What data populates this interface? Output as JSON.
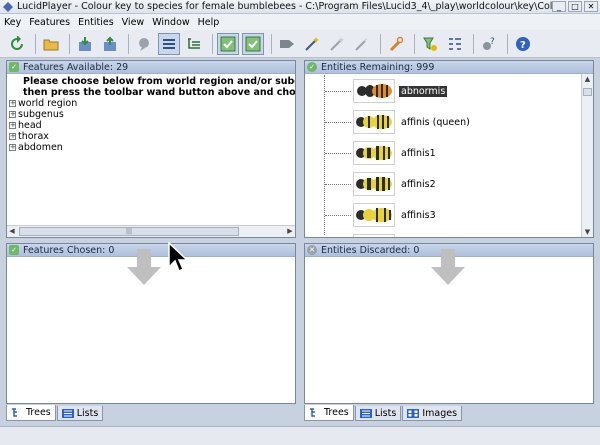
{
  "window": {
    "title": "LucidPlayer - Colour key to species for female bumblebees - C:\\Program Files\\Lucid3_4\\_play\\worldcolour\\key\\Colour key t...",
    "buttons": [
      "_",
      "□",
      "✕"
    ]
  },
  "menu": [
    "Key",
    "Features",
    "Entities",
    "View",
    "Window",
    "Help"
  ],
  "toolbar": {
    "icons": [
      "restart-icon",
      "open-folder-icon",
      "import-icon",
      "export-icon",
      "chat-icon",
      "list-view-icon",
      "tree-view-icon",
      "check-features-icon",
      "check-entities-icon",
      "tag-icon",
      "magic-wand-icon",
      "wand-disabled-icon",
      "wand-gray-icon",
      "tool-icon",
      "filter-icon",
      "sort-icon",
      "settings-help-icon",
      "help-icon"
    ]
  },
  "features_available": {
    "header": "Features Available: 29",
    "instructions": [
      "Please choose below from world region and/or subgenus (optio",
      "then press the toolbar wand button above and choose a feature"
    ],
    "items": [
      "world region",
      "subgenus",
      "head",
      "thorax",
      "abdomen"
    ]
  },
  "entities_remaining": {
    "header": "Entities Remaining: 999",
    "items": [
      {
        "name": "abnormis",
        "selected": true
      },
      {
        "name": "affinis (queen)",
        "selected": false
      },
      {
        "name": "affinis1",
        "selected": false
      },
      {
        "name": "affinis2",
        "selected": false
      },
      {
        "name": "affinis3",
        "selected": false
      }
    ]
  },
  "features_chosen": {
    "header": "Features Chosen: 0"
  },
  "entities_discarded": {
    "header": "Entities Discarded: 0"
  },
  "left_tabs": [
    "Trees",
    "Lists"
  ],
  "right_tabs": [
    "Trees",
    "Lists",
    "Images"
  ],
  "colors": {
    "header_bg": "#b6c6df",
    "selected_bg": "#333333",
    "bee_yellow": "#e8d23a",
    "bee_black": "#2b2b2b",
    "bee_orange": "#e28b2a",
    "arrow_gray": "#bfbfbf"
  }
}
